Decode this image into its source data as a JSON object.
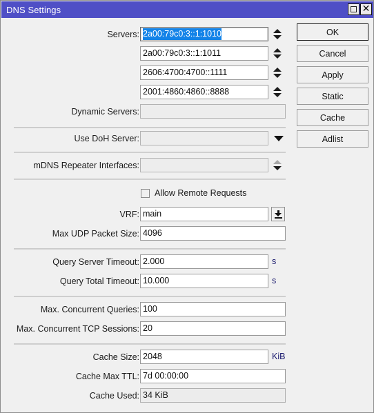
{
  "window": {
    "title": "DNS Settings",
    "title_bar_color": "#4f4fc6",
    "background_color": "#f0f0f0",
    "controls": {
      "maximize": "maximize-box",
      "close": "✕"
    }
  },
  "buttons": [
    {
      "label": "OK",
      "name": "ok-button",
      "default": true
    },
    {
      "label": "Cancel",
      "name": "cancel-button",
      "default": false
    },
    {
      "label": "Apply",
      "name": "apply-button",
      "default": false
    },
    {
      "label": "Static",
      "name": "static-button",
      "default": false
    },
    {
      "label": "Cache",
      "name": "cache-button",
      "default": false
    },
    {
      "label": "Adlist",
      "name": "adlist-button",
      "default": false
    }
  ],
  "form": {
    "servers_label": "Servers:",
    "servers": [
      {
        "value": "2a00:79c0:3::1:1010",
        "selected": true
      },
      {
        "value": "2a00:79c0:3::1:1011",
        "selected": false
      },
      {
        "value": "2606:4700:4700::1111",
        "selected": false
      },
      {
        "value": "2001:4860:4860::8888",
        "selected": false
      }
    ],
    "dynamic_servers_label": "Dynamic Servers:",
    "dynamic_servers_value": "",
    "doh_label": "Use DoH Server:",
    "doh_value": "",
    "mdns_label": "mDNS Repeater Interfaces:",
    "mdns_value": "",
    "allow_remote_requests_label": "Allow Remote Requests",
    "allow_remote_requests_checked": false,
    "vrf_label": "VRF:",
    "vrf_value": "main",
    "max_udp_label": "Max UDP Packet Size:",
    "max_udp_value": "4096",
    "query_server_timeout_label": "Query Server Timeout:",
    "query_server_timeout_value": "2.000",
    "query_server_timeout_unit": "s",
    "query_total_timeout_label": "Query Total Timeout:",
    "query_total_timeout_value": "10.000",
    "query_total_timeout_unit": "s",
    "max_queries_label": "Max. Concurrent Queries:",
    "max_queries_value": "100",
    "max_tcp_label": "Max. Concurrent TCP Sessions:",
    "max_tcp_value": "20",
    "cache_size_label": "Cache Size:",
    "cache_size_value": "2048",
    "cache_size_unit": "KiB",
    "cache_max_ttl_label": "Cache Max TTL:",
    "cache_max_ttl_value": "7d 00:00:00",
    "cache_used_label": "Cache Used:",
    "cache_used_value": "34 KiB"
  }
}
